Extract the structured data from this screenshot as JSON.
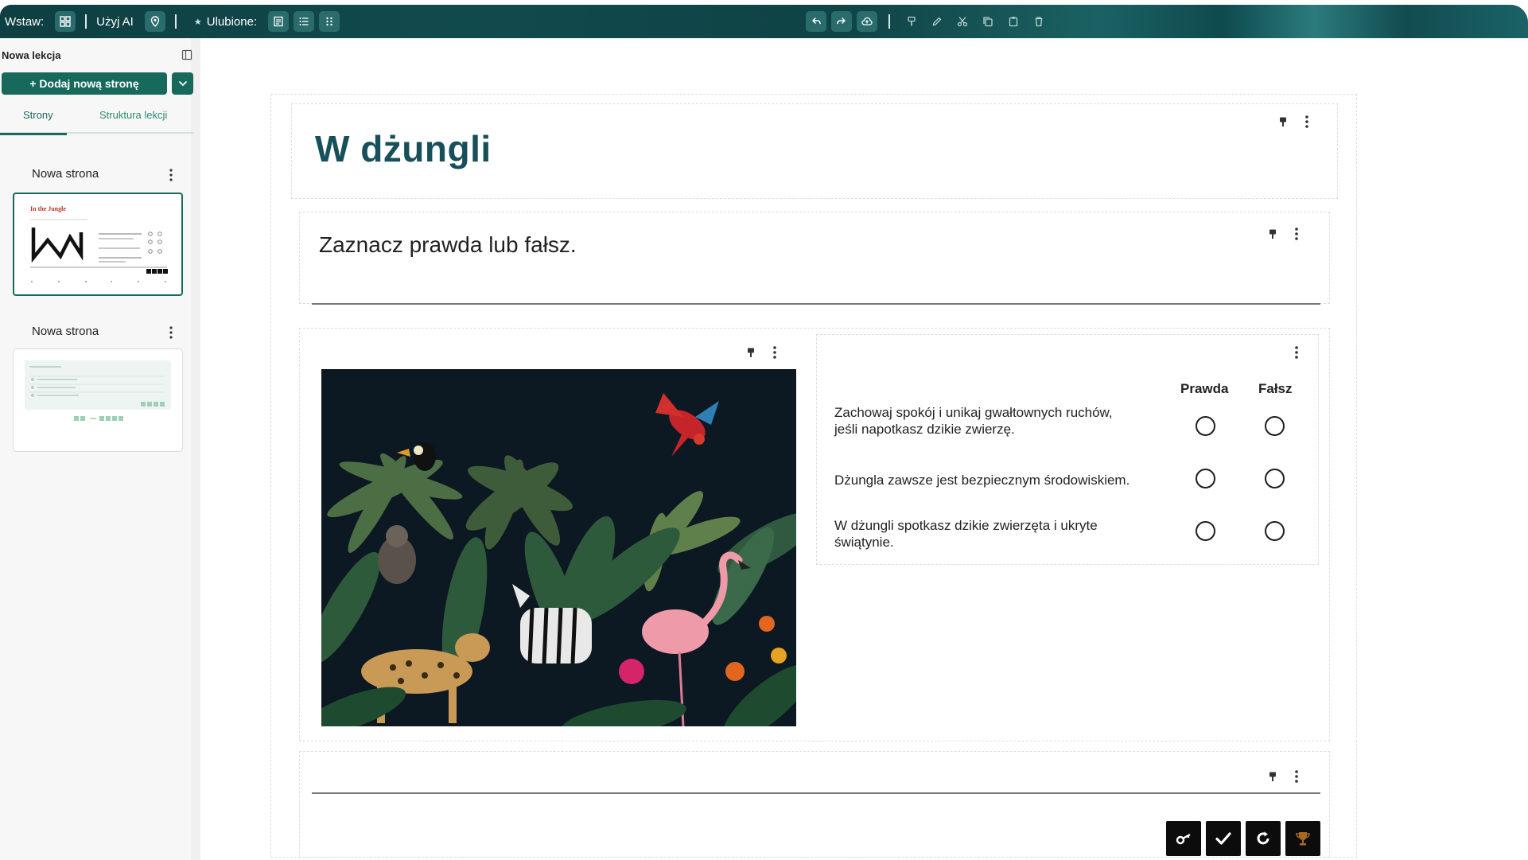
{
  "toolbar": {
    "insert_label": "Wstaw:",
    "ai_label": "Użyj AI",
    "favorites_label": "Ulubione:",
    "icons": [
      "grid-icon",
      "location-pin-icon",
      "document-icon",
      "list-icon",
      "columns-icon",
      "undo-icon",
      "redo-icon",
      "cloud-upload-icon",
      "paint-format-icon",
      "edit-icon",
      "cut-icon",
      "copy-icon",
      "paste-icon",
      "trash-icon"
    ]
  },
  "sidebar": {
    "lesson_title": "Nowa lekcja",
    "add_page_label": "+ Dodaj nową stronę",
    "tabs": [
      {
        "label": "Strony",
        "active": true
      },
      {
        "label": "Struktura lekcji",
        "active": false
      }
    ],
    "pages": [
      {
        "label": "Nowa strona",
        "thumb_title": "In the Jungle",
        "selected": true
      },
      {
        "label": "Nowa strona",
        "selected": false
      }
    ]
  },
  "content": {
    "title": "W dżungli",
    "instruction": "Zaznacz prawda lub fałsz.",
    "true_false": {
      "columns": [
        "Prawda",
        "Fałsz"
      ],
      "statements": [
        {
          "line1": "Zachowaj spokój i unikaj gwałtownych ruchów,",
          "line2": "jeśli napotkasz dzikie zwierzę."
        },
        {
          "line1": "Dżungla zawsze jest bezpiecznym środowiskiem.",
          "line2": ""
        },
        {
          "line1": "W dżungli spotkasz dzikie zwierzęta i ukryte",
          "line2": "świątynie."
        }
      ]
    },
    "actions": [
      "key-icon",
      "check-icon",
      "retry-icon",
      "trophy-icon"
    ]
  },
  "colors": {
    "accent": "#17695c",
    "title": "#17505a",
    "toolbar": "#0f4346"
  }
}
